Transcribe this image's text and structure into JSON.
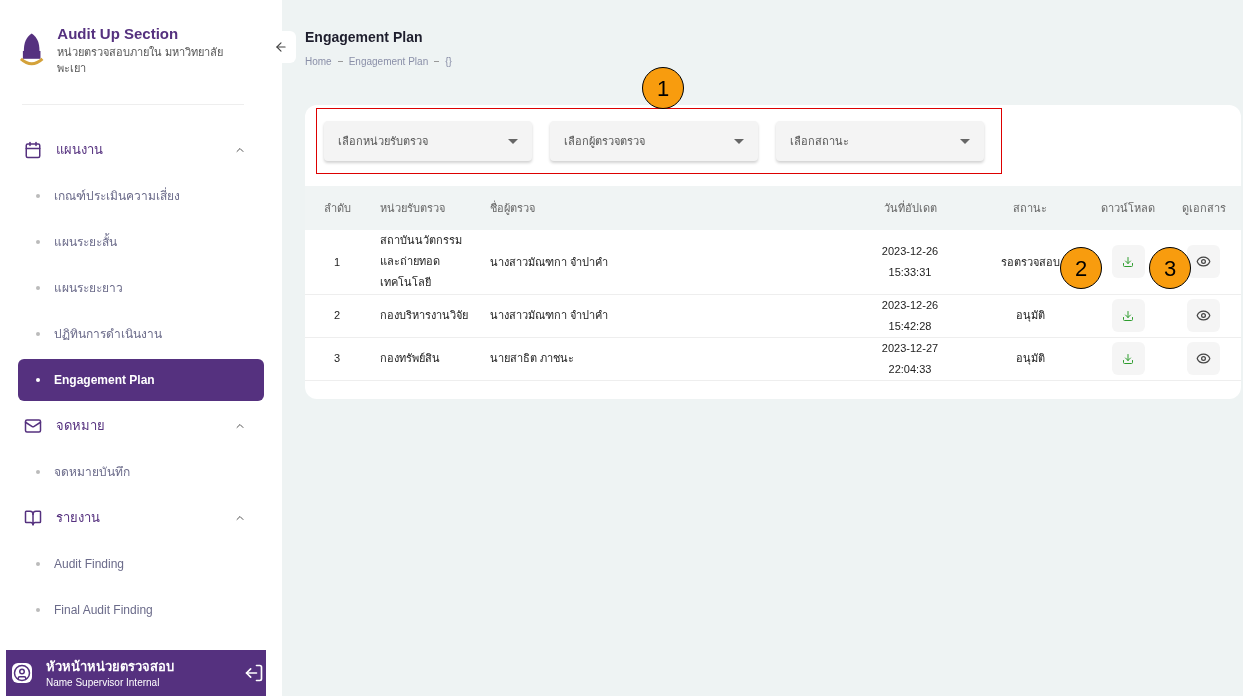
{
  "brand": {
    "title": "Audit Up Section",
    "subtitle": "หน่วยตรวจสอบภายใน มหาวิทยาลัยพะเยา"
  },
  "sidebar": {
    "groups": [
      {
        "label": "แผนงาน",
        "expanded": true,
        "items": [
          {
            "label": "เกณฑ์ประเมินความเสี่ยง",
            "selected": false
          },
          {
            "label": "แผนระยะสั้น",
            "selected": false
          },
          {
            "label": "แผนระยะยาว",
            "selected": false
          },
          {
            "label": "ปฏิทินการดำเนินงาน",
            "selected": false
          },
          {
            "label": "Engagement Plan",
            "selected": true
          }
        ]
      },
      {
        "label": "จดหมาย",
        "expanded": true,
        "items": [
          {
            "label": "จดหมายบันทึก",
            "selected": false
          }
        ]
      },
      {
        "label": "รายงาน",
        "expanded": true,
        "items": [
          {
            "label": "Audit Finding",
            "selected": false
          },
          {
            "label": "Final Audit Finding",
            "selected": false
          }
        ]
      }
    ]
  },
  "user": {
    "role": "หัวหน้าหน่วยตรวจสอบ",
    "name": "Name Supervisor Internal"
  },
  "page": {
    "title": "Engagement Plan",
    "breadcrumb": [
      "Home",
      "Engagement Plan",
      "{}"
    ]
  },
  "filters": [
    {
      "placeholder": "เลือกหน่วยรับตรวจ"
    },
    {
      "placeholder": "เลือกผู้ตรวจตรวจ"
    },
    {
      "placeholder": "เลือกสถานะ"
    }
  ],
  "table": {
    "columns": [
      "ลำดับ",
      "หน่วยรับตรวจ",
      "ชื่อผู้ตรวจ",
      "วันที่อัปเดต",
      "สถานะ",
      "ดาวน์โหลด",
      "ดูเอกสาร"
    ],
    "rows": [
      {
        "no": "1",
        "unit": "สถาบันนวัตกรรมและถ่ายทอดเทคโนโลยี",
        "auditor": "นางสาวมัณฑกา จำปาคำ",
        "date": "2023-12-26",
        "time": "15:33:31",
        "status": "รอตรวจสอบ"
      },
      {
        "no": "2",
        "unit": "กองบริหารงานวิจัย",
        "auditor": "นางสาวมัณฑกา จำปาคำ",
        "date": "2023-12-26",
        "time": "15:42:28",
        "status": "อนุมัติ"
      },
      {
        "no": "3",
        "unit": "กองทรัพย์สิน",
        "auditor": "นายสาธิต ภาชนะ",
        "date": "2023-12-27",
        "time": "22:04:33",
        "status": "อนุมัติ"
      }
    ]
  },
  "callouts": [
    {
      "label": "1"
    },
    {
      "label": "2"
    },
    {
      "label": "3"
    }
  ]
}
